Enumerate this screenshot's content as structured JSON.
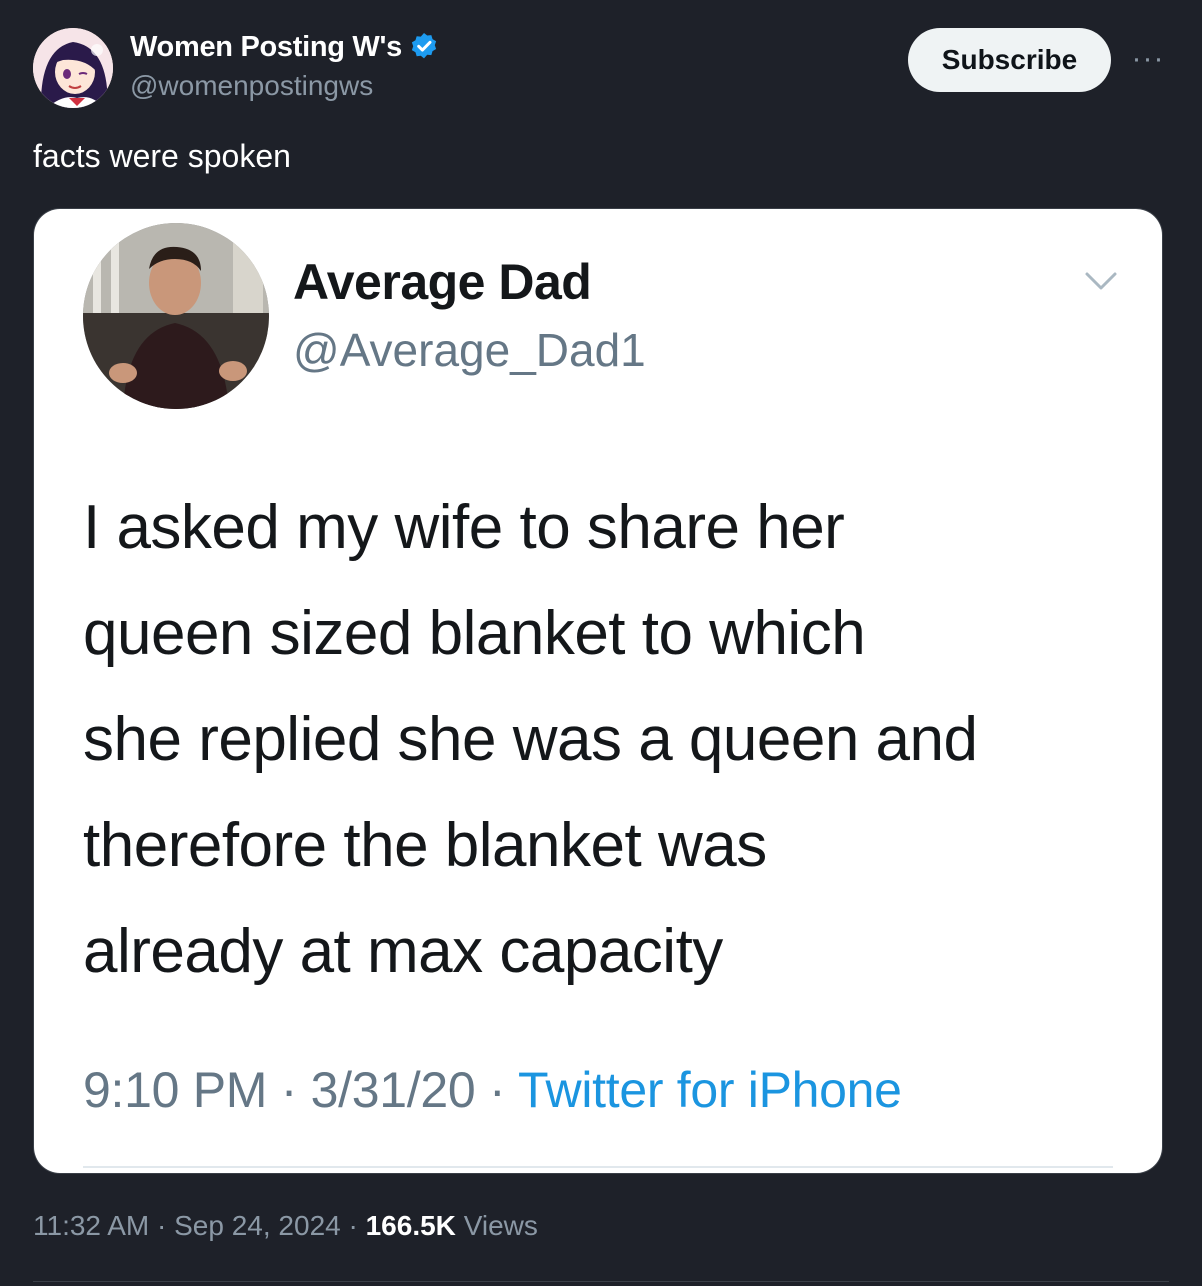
{
  "post": {
    "author_name": "Women Posting W's",
    "author_handle": "@womenpostingws",
    "verified": true,
    "subscribe_label": "Subscribe",
    "more_label": "···",
    "text": "facts were spoken",
    "time": "11:32 AM",
    "date": "Sep 24, 2024",
    "views_count": "166.5K",
    "views_label": "Views",
    "separator": " · "
  },
  "embedded_tweet": {
    "author_name": "Average Dad",
    "author_handle": "@Average_Dad1",
    "text_lines": [
      "I asked my wife to share her",
      "queen sized blanket to which",
      "she replied she was a queen and",
      "therefore the blanket was",
      "already at max capacity"
    ],
    "time": "9:10 PM",
    "date": "3/31/20",
    "source": "Twitter for iPhone",
    "separator": " · "
  },
  "colors": {
    "background": "#1e2129",
    "verified": "#1d9bf0",
    "link": "#1b95e0",
    "muted": "#8b98a5"
  },
  "icons": [
    "verified-badge-icon",
    "more-icon",
    "chevron-down-icon"
  ]
}
